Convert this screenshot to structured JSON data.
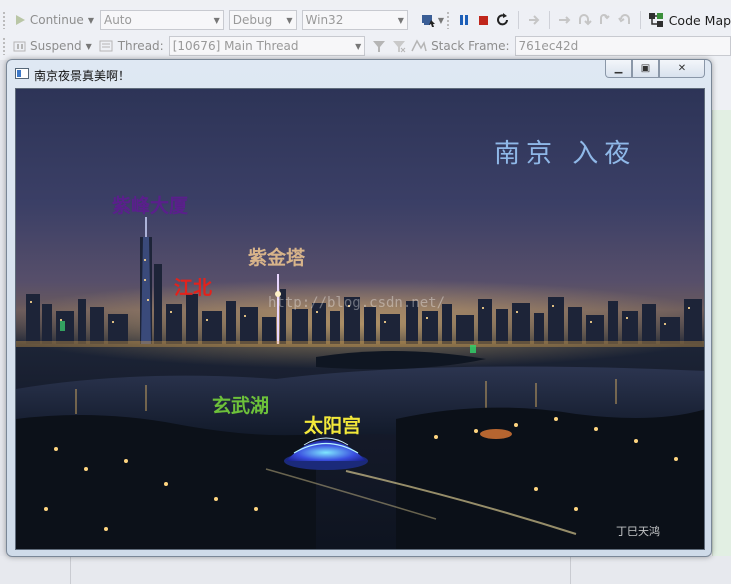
{
  "toolbar1": {
    "continue_label": "Continue",
    "solution_config": "Auto",
    "build_config": "Debug",
    "platform": "Win32",
    "code_map_label": "Code Map"
  },
  "toolbar2": {
    "suspend_label": "Suspend",
    "thread_label": "Thread:",
    "thread_value": "[10676] Main Thread",
    "stack_frame_label": "Stack Frame:",
    "stack_frame_value": "761ec42d"
  },
  "window": {
    "title": "南京夜景真美啊！"
  },
  "image": {
    "heading": "南京  入夜",
    "labels": {
      "zifeng": "紫峰大厦",
      "jiangbei": "江北",
      "zijin_tower": "紫金塔",
      "xuanwu_lake": "玄武湖",
      "sun_palace": "太阳宫"
    },
    "watermark": "http://blog.csdn.net/",
    "signature": "丁巳天鸿"
  },
  "colors": {
    "pause": "#1c5fb8",
    "stop": "#c0261b",
    "zifeng": "#5a1f8c",
    "jiangbei": "#e3221c",
    "zijin": "#d8b48a",
    "xuanwu": "#6dc13a",
    "sun": "#f2e83a",
    "heading": "#8fb8e8"
  }
}
